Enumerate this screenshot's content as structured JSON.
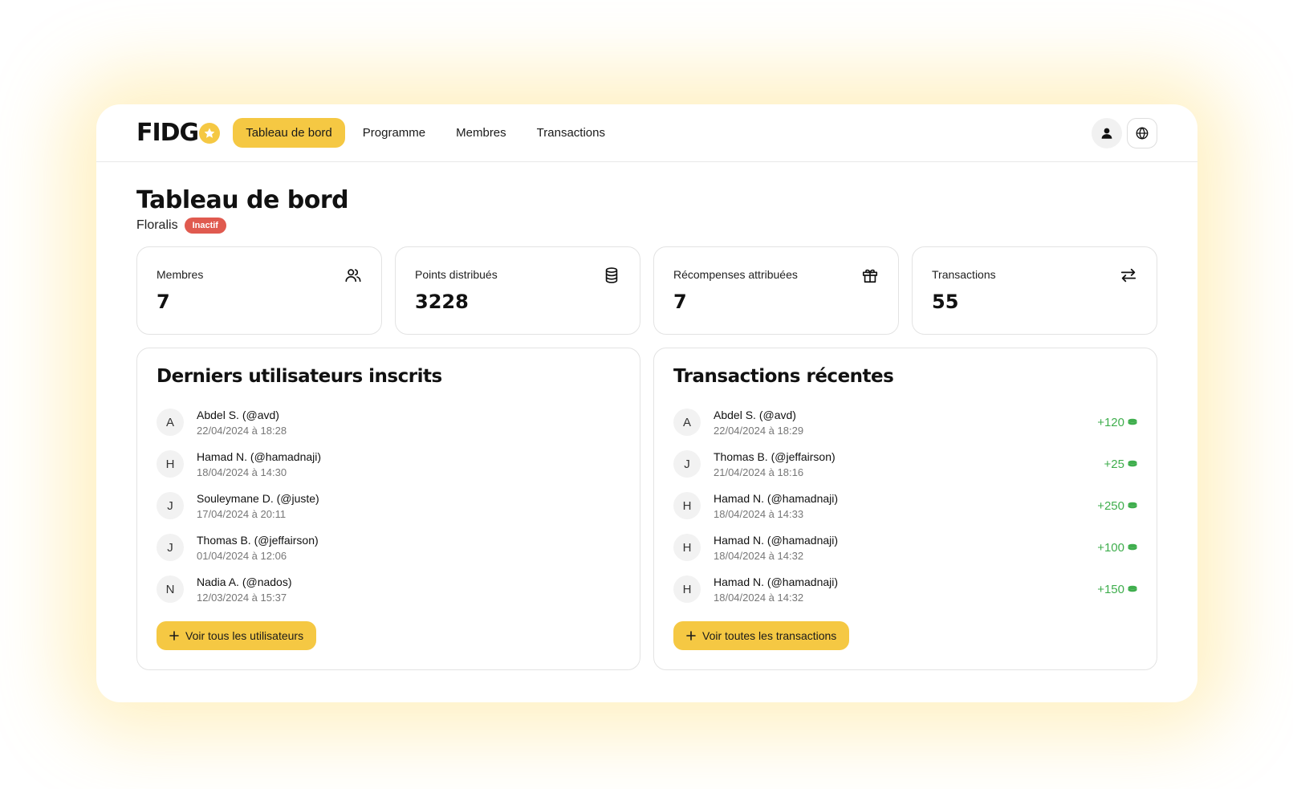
{
  "colors": {
    "accent": "#f5c843",
    "badge_inactive": "#e05a4f",
    "points_green": "#3fae4d"
  },
  "brand": {
    "logo_text": "FIDG",
    "logo_icon": "star-coin-icon"
  },
  "nav": {
    "items": [
      {
        "label": "Tableau de bord",
        "active": true
      },
      {
        "label": "Programme",
        "active": false
      },
      {
        "label": "Membres",
        "active": false
      },
      {
        "label": "Transactions",
        "active": false
      }
    ]
  },
  "header_actions": [
    {
      "icon": "user-icon"
    },
    {
      "icon": "globe-icon"
    }
  ],
  "page": {
    "title": "Tableau de bord",
    "org_name": "Floralis",
    "status": "Inactif"
  },
  "stats": [
    {
      "label": "Membres",
      "value": "7",
      "icon": "users-icon"
    },
    {
      "label": "Points distribués",
      "value": "3228",
      "icon": "database-icon"
    },
    {
      "label": "Récompenses attribuées",
      "value": "7",
      "icon": "gift-icon"
    },
    {
      "label": "Transactions",
      "value": "55",
      "icon": "arrows-exchange-icon"
    }
  ],
  "recent_users": {
    "title": "Derniers utilisateurs inscrits",
    "items": [
      {
        "initial": "A",
        "name": "Abdel S. (@avd)",
        "date": "22/04/2024 à 18:28"
      },
      {
        "initial": "H",
        "name": "Hamad N. (@hamadnaji)",
        "date": "18/04/2024 à 14:30"
      },
      {
        "initial": "J",
        "name": "Souleymane D. (@juste)",
        "date": "17/04/2024 à 20:11"
      },
      {
        "initial": "J",
        "name": "Thomas B. (@jeffairson)",
        "date": "01/04/2024 à 12:06"
      },
      {
        "initial": "N",
        "name": "Nadia A. (@nados)",
        "date": "12/03/2024 à 15:37"
      }
    ],
    "button": "Voir tous les utilisateurs"
  },
  "recent_transactions": {
    "title": "Transactions récentes",
    "items": [
      {
        "initial": "A",
        "name": "Abdel S. (@avd)",
        "date": "22/04/2024 à 18:29",
        "points": "+120"
      },
      {
        "initial": "J",
        "name": "Thomas B. (@jeffairson)",
        "date": "21/04/2024 à 18:16",
        "points": "+25"
      },
      {
        "initial": "H",
        "name": "Hamad N. (@hamadnaji)",
        "date": "18/04/2024 à 14:33",
        "points": "+250"
      },
      {
        "initial": "H",
        "name": "Hamad N. (@hamadnaji)",
        "date": "18/04/2024 à 14:32",
        "points": "+100"
      },
      {
        "initial": "H",
        "name": "Hamad N. (@hamadnaji)",
        "date": "18/04/2024 à 14:32",
        "points": "+150"
      }
    ],
    "button": "Voir toutes les transactions"
  }
}
